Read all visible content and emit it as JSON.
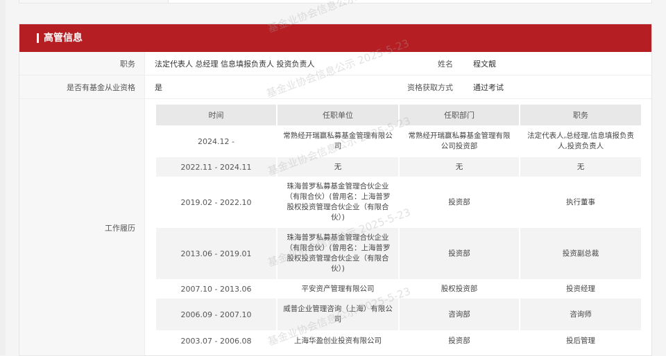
{
  "header": {
    "title": "高管信息"
  },
  "info": {
    "position_label": "职务",
    "position_value": "法定代表人 总经理 信息填报负责人 投资负责人",
    "name_label": "姓名",
    "name_value": "程文靓",
    "qualification_label": "是否有基金从业资格",
    "qualification_value": "是",
    "method_label": "资格获取方式",
    "method_value": "通过考试",
    "history_label": "工作履历"
  },
  "history": {
    "columns": [
      "时间",
      "任职单位",
      "任职部门",
      "职务"
    ],
    "rows": [
      [
        "2024.12 -",
        "常熟经开瑞赢私募基金管理有限公司",
        "常熟经开瑞赢私募基金管理有限公司投资部",
        "法定代表人,总经理,信息填报负责人,投资负责人"
      ],
      [
        "2022.11 - 2024.11",
        "无",
        "无",
        "无"
      ],
      [
        "2019.02 - 2022.10",
        "珠海普罗私募基金管理合伙企业（有限合伙）(曾用名：上海普罗股权投资管理合伙企业（有限合伙）)",
        "投资部",
        "执行董事"
      ],
      [
        "2013.06 - 2019.01",
        "珠海普罗私募基金管理合伙企业（有限合伙）(曾用名：上海普罗股权投资管理合伙企业（有限合伙）)",
        "投资部",
        "投资副总裁"
      ],
      [
        "2007.10 - 2013.06",
        "平安资产管理有限公司",
        "股权投资部",
        "投资经理"
      ],
      [
        "2006.09 - 2007.10",
        "威普企业管理咨询（上海）有限公司",
        "咨询部",
        "咨询师"
      ],
      [
        "2003.07 - 2006.08",
        "上海华盈创业投资有限公司",
        "投资部",
        "投后管理"
      ]
    ]
  },
  "watermark": {
    "text": "基金业协会信息公示 2025-5-23"
  },
  "colors": {
    "accent": "#b51e22"
  }
}
